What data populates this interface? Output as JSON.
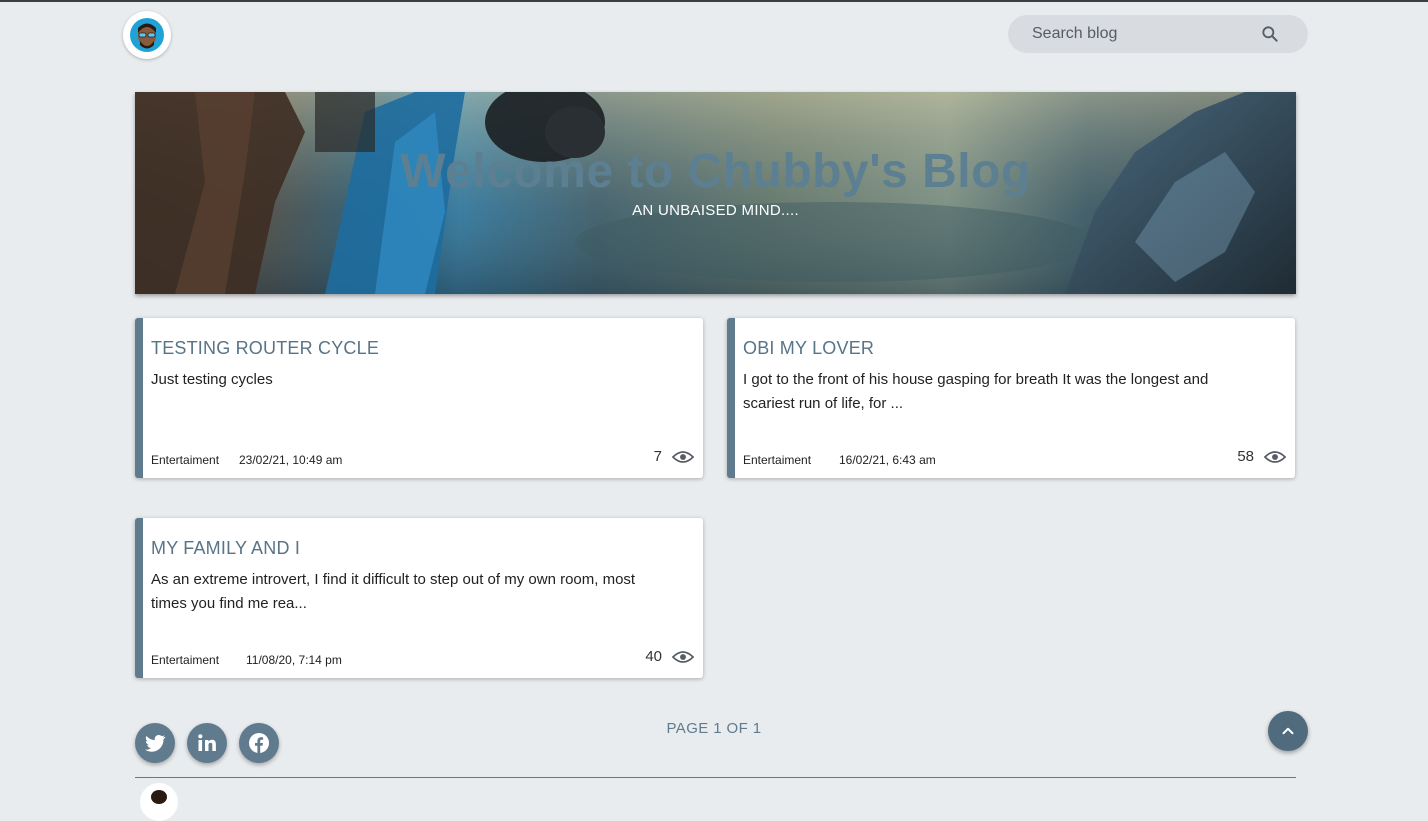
{
  "header": {
    "avatar_icon": "avatar-icon",
    "search": {
      "placeholder": "Search blog",
      "icon": "search-icon"
    }
  },
  "hero": {
    "title": "Welcome to Chubby's Blog",
    "subtitle": "AN UNBAISED MIND...."
  },
  "posts": [
    {
      "title": "TESTING ROUTER CYCLE",
      "excerpt": "Just testing cycles",
      "category": "Entertaiment",
      "date": "23/02/21, 10:49 am",
      "views": "7"
    },
    {
      "title": "OBI MY LOVER",
      "excerpt": "I got to the front of his house gasping for breath It was the longest and scariest run of life, for ...",
      "category": "Entertaiment",
      "date": "16/02/21, 6:43 am",
      "views": "58"
    },
    {
      "title": "MY FAMILY AND I",
      "excerpt": "As an extreme introvert, I find it difficult to step out of my own room, most times you find me rea...",
      "category": "Entertaiment",
      "date": "11/08/20, 7:14 pm",
      "views": "40"
    }
  ],
  "pagination": {
    "label": "PAGE 1 OF 1"
  },
  "social": {
    "icons": [
      "twitter-icon",
      "linkedin-icon",
      "facebook-icon"
    ]
  },
  "colors": {
    "accent": "#5f7b8d",
    "background": "#e9ecef",
    "title": "#587487"
  }
}
